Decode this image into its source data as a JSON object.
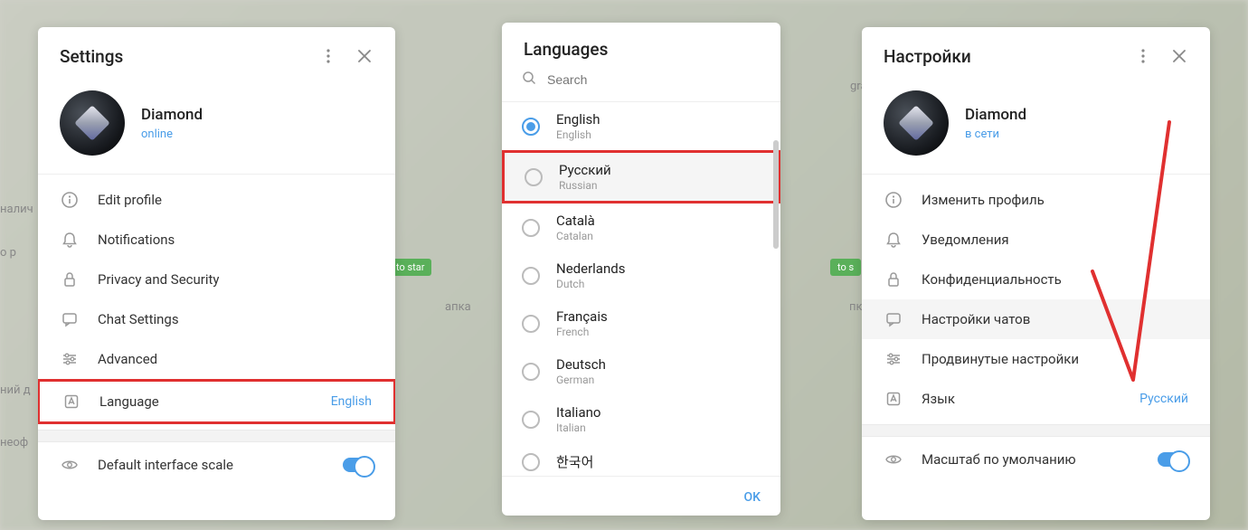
{
  "panel1": {
    "title": "Settings",
    "profile": {
      "name": "Diamond",
      "status": "online"
    },
    "menu": [
      {
        "label": "Edit profile"
      },
      {
        "label": "Notifications"
      },
      {
        "label": "Privacy and Security"
      },
      {
        "label": "Chat Settings"
      },
      {
        "label": "Advanced"
      },
      {
        "label": "Language",
        "value": "English"
      }
    ],
    "scale_label": "Default interface scale"
  },
  "panel2": {
    "title": "Languages",
    "search_placeholder": "Search",
    "languages": [
      {
        "native": "English",
        "english": "English",
        "selected": true
      },
      {
        "native": "Русский",
        "english": "Russian",
        "selected": false,
        "boxed": true
      },
      {
        "native": "Català",
        "english": "Catalan",
        "selected": false
      },
      {
        "native": "Nederlands",
        "english": "Dutch",
        "selected": false
      },
      {
        "native": "Français",
        "english": "French",
        "selected": false
      },
      {
        "native": "Deutsch",
        "english": "German",
        "selected": false
      },
      {
        "native": "Italiano",
        "english": "Italian",
        "selected": false
      },
      {
        "native": "한국어",
        "english": "",
        "selected": false
      }
    ],
    "ok": "OK"
  },
  "panel3": {
    "title": "Настройки",
    "profile": {
      "name": "Diamond",
      "status": "в сети"
    },
    "menu": [
      {
        "label": "Изменить профиль"
      },
      {
        "label": "Уведомления"
      },
      {
        "label": "Конфиденциальность"
      },
      {
        "label": "Настройки чатов"
      },
      {
        "label": "Продвинутые настройки"
      },
      {
        "label": "Язык",
        "value": "Русский"
      }
    ],
    "scale_label": "Масштаб по умолчанию"
  },
  "bg": {
    "to_start": "to star",
    "to_start2": "to s",
    "panka": "апка",
    "panka2": "пка",
    "op": "о р",
    "nalich": "налич",
    "neof": "неоф",
    "nij_d": "ний д",
    "gram": "gram.m"
  }
}
